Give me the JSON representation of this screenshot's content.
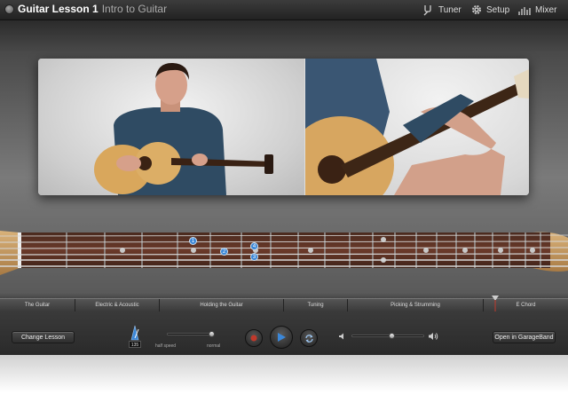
{
  "titlebar": {
    "title": "Guitar Lesson 1",
    "subtitle": "Intro to Guitar",
    "tuner_label": "Tuner",
    "setup_label": "Setup",
    "mixer_label": "Mixer"
  },
  "fretboard": {
    "finger_markers": [
      "1",
      "2",
      "3",
      "4"
    ]
  },
  "lesson_nav": {
    "items": [
      "The Guitar",
      "Electric & Acoustic",
      "Holding the Guitar",
      "Tuning",
      "Picking & Strumming",
      "E Chord"
    ]
  },
  "controls": {
    "change_lesson_label": "Change Lesson",
    "metronome_tempo": "135",
    "half_speed_label": "half speed",
    "normal_label": "normal",
    "speed_level": 1.0,
    "volume_level": 0.55,
    "open_garageband_label": "Open in GarageBand"
  },
  "colors": {
    "accent": "#3b87d8",
    "record": "#c0392b",
    "wood": "#6b3a2a"
  }
}
